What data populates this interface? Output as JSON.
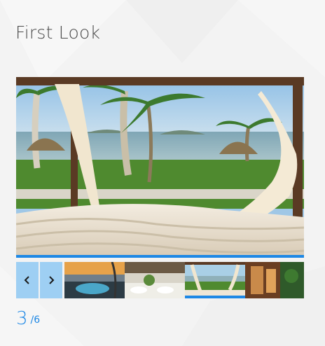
{
  "gallery": {
    "title": "First Look",
    "prev_icon": "chevron-left-icon",
    "next_icon": "chevron-right-icon",
    "current_page": "3",
    "total_pages": "/6",
    "thumbnails": [
      {
        "name": "thumb-jacuzzi-sunset",
        "active": false
      },
      {
        "name": "thumb-dining-room",
        "active": false
      },
      {
        "name": "thumb-beach-cabana",
        "active": true
      },
      {
        "name": "thumb-wooden-lounge",
        "active": false
      }
    ],
    "accent_color": "#1e88e5",
    "nav_color": "#9ecff3"
  }
}
